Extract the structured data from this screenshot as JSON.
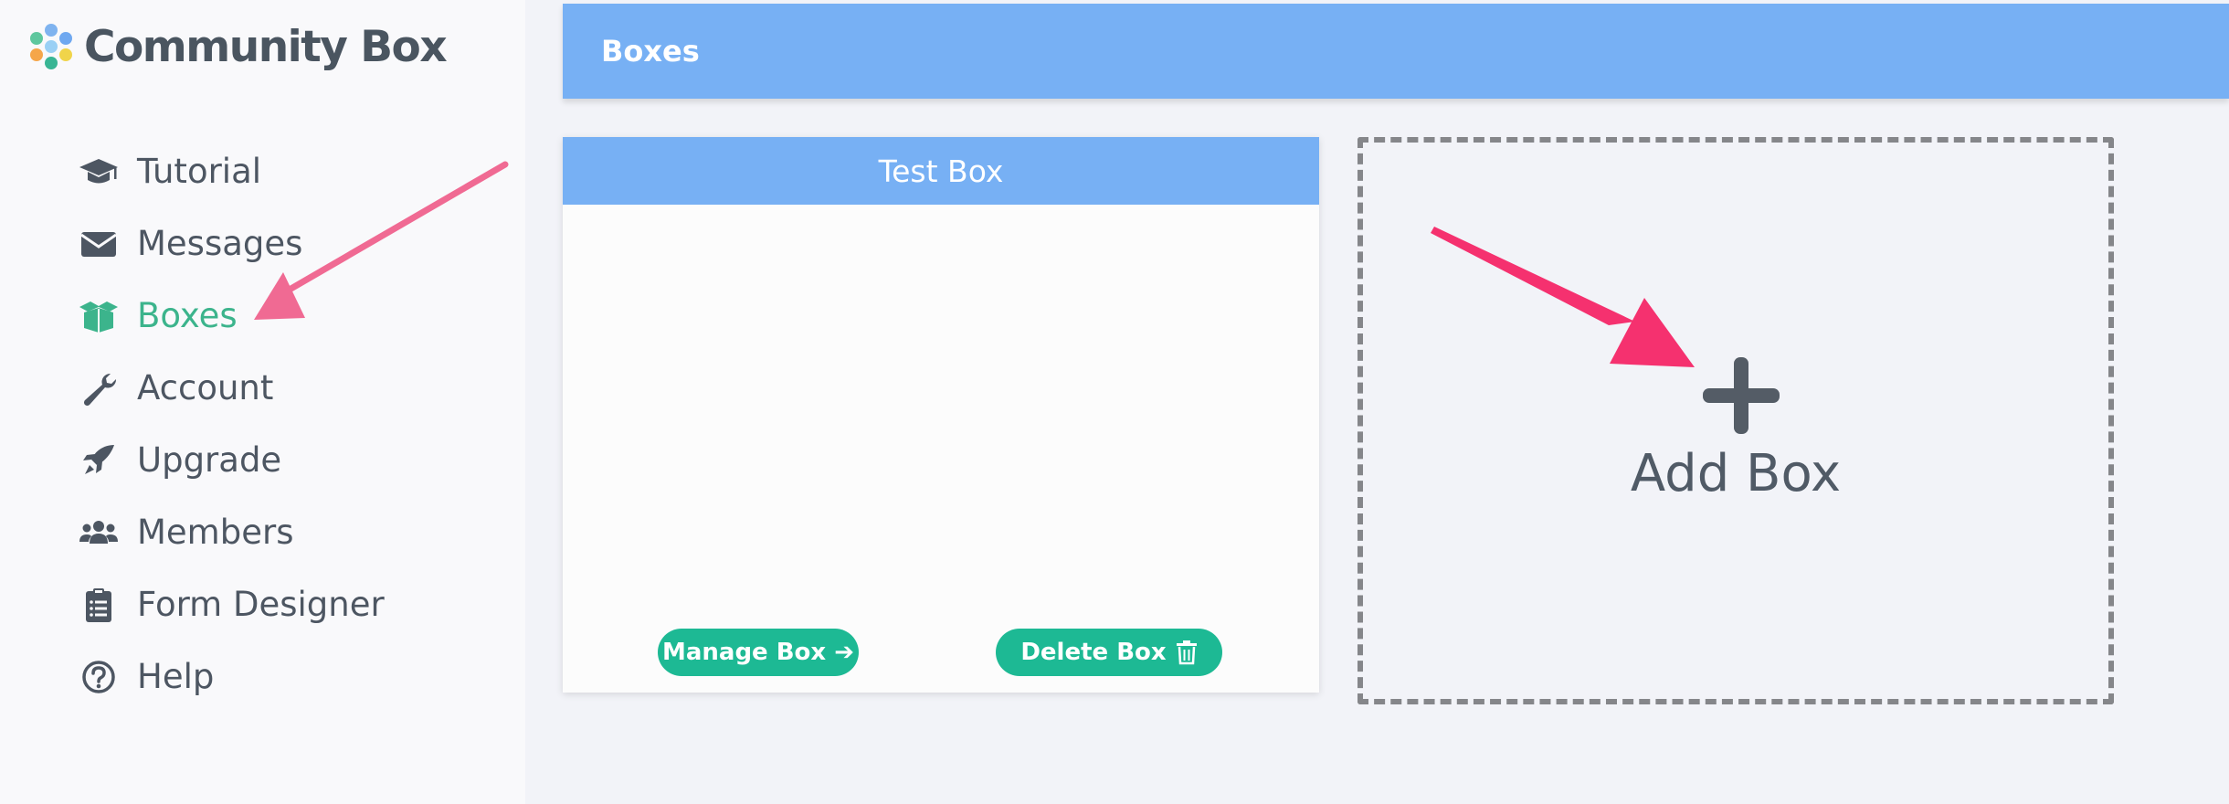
{
  "app": {
    "logo_text": "Community Box"
  },
  "sidebar": {
    "items": [
      {
        "label": "Tutorial",
        "icon": "graduation-cap-icon",
        "active": false
      },
      {
        "label": "Messages",
        "icon": "envelope-icon",
        "active": false
      },
      {
        "label": "Boxes",
        "icon": "box-open-icon",
        "active": true
      },
      {
        "label": "Account",
        "icon": "wrench-icon",
        "active": false
      },
      {
        "label": "Upgrade",
        "icon": "rocket-icon",
        "active": false
      },
      {
        "label": "Members",
        "icon": "users-icon",
        "active": false
      },
      {
        "label": "Form Designer",
        "icon": "clipboard-list-icon",
        "active": false
      },
      {
        "label": "Help",
        "icon": "question-circle-icon",
        "active": false
      }
    ]
  },
  "header": {
    "title": "Boxes"
  },
  "boxes": [
    {
      "title": "Test Box",
      "manage_label": "Manage Box ➔",
      "delete_label": "Delete Box"
    }
  ],
  "add_box": {
    "label": "Add Box",
    "icon": "plus-icon"
  },
  "colors": {
    "accent_blue": "#77b0f4",
    "active_green": "#3cb48c",
    "button_teal": "#1db994",
    "arrow_pink": "#f06a93",
    "arrow_magenta": "#f5316f"
  }
}
